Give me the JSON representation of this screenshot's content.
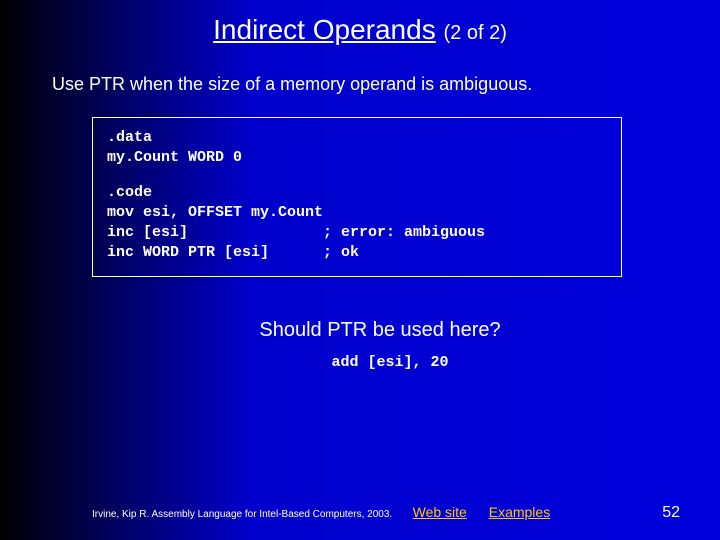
{
  "title": {
    "main": "Indirect Operands",
    "part": "(2 of 2)"
  },
  "subtitle": "Use PTR when the size of a memory operand is ambiguous.",
  "codebox": {
    "block1": ".data\nmy.Count WORD 0",
    "block2": ".code\nmov esi, OFFSET my.Count\ninc [esi]               ; error: ambiguous\ninc WORD PTR [esi]      ; ok"
  },
  "question": "Should PTR be used here?",
  "snippet": "add [esi], 20",
  "footer": {
    "credit": "Irvine, Kip R. Assembly Language for Intel-Based Computers, 2003.",
    "link1": "Web site",
    "link2": "Examples",
    "page": "52"
  }
}
